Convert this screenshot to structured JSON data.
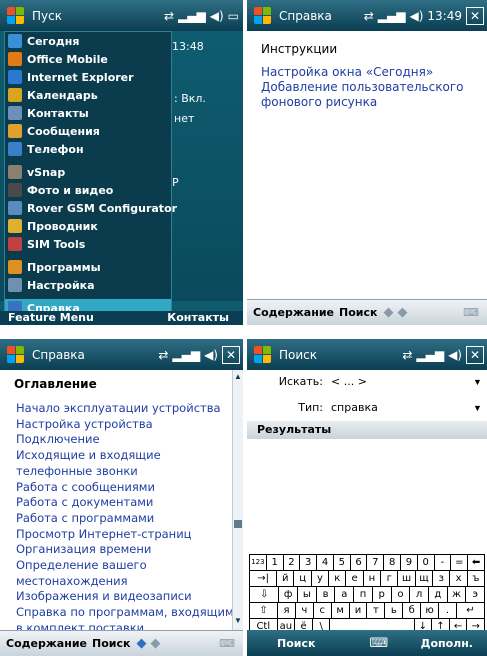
{
  "screen1": {
    "title": "Пуск",
    "clock": "13:48",
    "bt_status": ": Вкл.",
    "today_net": "нет",
    "today_p": "Р",
    "softkey_left": "Feature Menu",
    "softkey_right": "Контакты",
    "menu": [
      {
        "label": "Сегодня",
        "icon": "today-icon",
        "color": "#3a8fd6"
      },
      {
        "label": "Office Mobile",
        "icon": "office-icon",
        "color": "#e07b18"
      },
      {
        "label": "Internet Explorer",
        "icon": "ie-icon",
        "color": "#2a78d0"
      },
      {
        "label": "Календарь",
        "icon": "calendar-icon",
        "color": "#d8a520"
      },
      {
        "label": "Контакты",
        "icon": "contacts-icon",
        "color": "#6d8fb8"
      },
      {
        "label": "Сообщения",
        "icon": "messages-icon",
        "color": "#e0a030"
      },
      {
        "label": "Телефон",
        "icon": "phone-icon",
        "color": "#3a80c8"
      },
      {
        "label": "vSnap",
        "icon": "vsnap-icon",
        "color": "#8a7f70"
      },
      {
        "label": "Фото и видео",
        "icon": "photo-icon",
        "color": "#4a4a4a"
      },
      {
        "label": "Rover GSM Configurator",
        "icon": "rover-icon",
        "color": "#5a8cc0"
      },
      {
        "label": "Проводник",
        "icon": "explorer-icon",
        "color": "#e0b030"
      },
      {
        "label": "SIM Tools",
        "icon": "sim-icon",
        "color": "#c04040"
      },
      {
        "label": "Программы",
        "icon": "programs-icon",
        "color": "#e09020"
      },
      {
        "label": "Настройка",
        "icon": "settings-icon",
        "color": "#7090b0"
      },
      {
        "label": "Справка",
        "icon": "help-icon",
        "color": "#3a70c0"
      }
    ]
  },
  "screen2": {
    "title": "Справка",
    "clock": "13:49",
    "heading": "Инструкции",
    "link1": "Настройка окна «Сегодня»",
    "link2_line1": "Добавление пользовательского",
    "link2_line2": "фонового рисунка",
    "bottom_contents": "Содержание",
    "bottom_search": "Поиск"
  },
  "screen3": {
    "title": "Справка",
    "heading": "Оглавление",
    "links": [
      "Начало эксплуатации устройства",
      "Настройка устройства",
      "Подключение",
      "Исходящие и входящие",
      "телефонные звонки",
      "Работа с сообщениями",
      "Работа с документами",
      "Работа с программами",
      "Просмотр Интернет-страниц",
      "Организация времени",
      "Определение вашего",
      "местонахождения",
      "Изображения и видеозаписи",
      "Справка по программам, входящим",
      "в комплект поставки"
    ],
    "bottom_contents": "Содержание",
    "bottom_search": "Поиск"
  },
  "screen4": {
    "title": "Поиск",
    "search_label": "Искать:",
    "search_value": "< ... >",
    "type_label": "Тип:",
    "type_value": "справка",
    "results_label": "Результаты",
    "softkey_left": "Поиск",
    "softkey_right": "Дополн.",
    "keyboard": [
      [
        "123",
        "1",
        "2",
        "3",
        "4",
        "5",
        "6",
        "7",
        "8",
        "9",
        "0",
        "-",
        "=",
        "⬅"
      ],
      [
        "→|",
        "й",
        "ц",
        "у",
        "к",
        "е",
        "н",
        "г",
        "ш",
        "щ",
        "з",
        "х",
        "ъ"
      ],
      [
        "⇩",
        "ф",
        "ы",
        "в",
        "а",
        "п",
        "р",
        "о",
        "л",
        "д",
        "ж",
        "э"
      ],
      [
        "⇧",
        "я",
        "ч",
        "с",
        "м",
        "и",
        "т",
        "ь",
        "б",
        "ю",
        ".",
        "↵"
      ],
      [
        "Ctl",
        "au",
        "ё",
        "\\",
        "",
        "↓",
        "↑",
        "←",
        "→"
      ]
    ]
  },
  "colors": {
    "accent": "#0b3e52",
    "link": "#1f3ea3",
    "selected": "#31a8c4"
  }
}
